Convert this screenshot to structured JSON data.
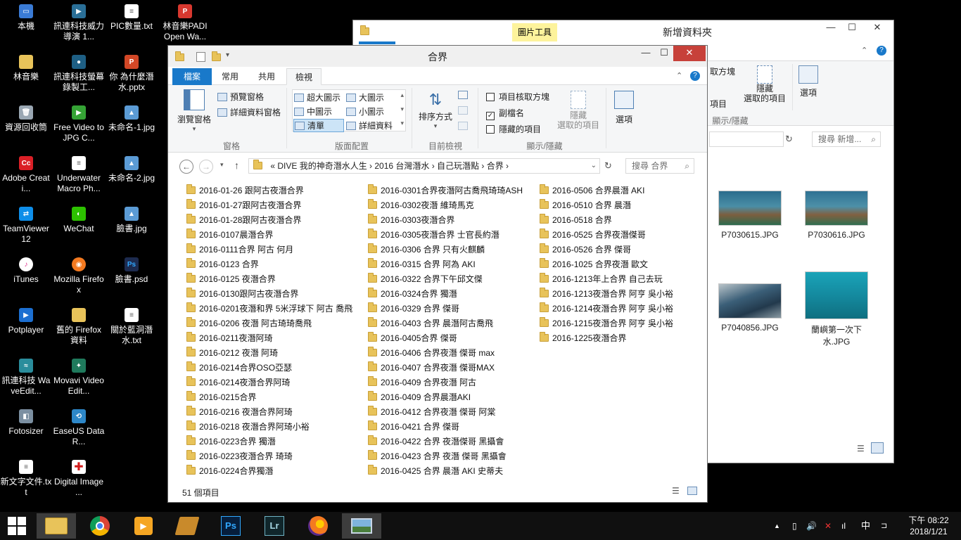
{
  "desktop": {
    "icons": [
      {
        "label": "本機"
      },
      {
        "label": "訊連科技威力導演 1..."
      },
      {
        "label": "PIC數量.txt"
      },
      {
        "label": "林音樂PADI Open Wa..."
      },
      {
        "label": "林音樂"
      },
      {
        "label": "訊連科技螢幕錄製工..."
      },
      {
        "label": "你 為什麼潛水.pptx"
      },
      {
        "label": "資源回收筒"
      },
      {
        "label": "Free Video to JPG C..."
      },
      {
        "label": "未命名-1.jpg"
      },
      {
        "label": "Adobe Creati..."
      },
      {
        "label": "Underwater Macro Ph..."
      },
      {
        "label": "未命名-2.jpg"
      },
      {
        "label": "TeamViewer 12"
      },
      {
        "label": "WeChat"
      },
      {
        "label": "臉書.jpg"
      },
      {
        "label": "iTunes"
      },
      {
        "label": "Mozilla Firefox"
      },
      {
        "label": "臉書.psd"
      },
      {
        "label": "Potplayer"
      },
      {
        "label": "舊的 Firefox 資料"
      },
      {
        "label": "關於藍洞潛水.txt"
      },
      {
        "label": "訊連科技 WaveEdit..."
      },
      {
        "label": "Movavi Video Edit..."
      },
      {
        "label": "Fotosizer"
      },
      {
        "label": "EaseUS Data R..."
      },
      {
        "label": "新文字文件.txt"
      },
      {
        "label": "Digital Image ..."
      }
    ]
  },
  "back_window": {
    "title": "新增資料夾",
    "context_tab": "圖片工具",
    "ribbon": {
      "item_checkbox_partial": "取方塊",
      "item_ext_partial": "項目",
      "hide_selected": "隱藏\n選取的項目",
      "options": "選項",
      "group_show_hide": "顯示/隱藏"
    },
    "search_placeholder": "搜尋 新增...",
    "thumbnails": [
      {
        "name": "P7030615.JPG"
      },
      {
        "name": "P7030616.JPG"
      },
      {
        "name": "P7040856.JPG"
      },
      {
        "name": "蘭嶼第一次下水.JPG"
      }
    ]
  },
  "front_window": {
    "title": "合界",
    "tabs": {
      "file": "檔案",
      "home": "常用",
      "share": "共用",
      "view": "檢視"
    },
    "ribbon": {
      "nav_pane": "瀏覽窗格",
      "preview_pane": "預覽窗格",
      "details_pane": "詳細資料窗格",
      "group_panes": "窗格",
      "layout": [
        "超大圖示",
        "大圖示",
        "中圖示",
        "小圖示",
        "清單",
        "詳細資料"
      ],
      "group_layout": "版面配置",
      "sort_by": "排序方式",
      "group_current_view": "目前檢視",
      "item_checkboxes": "項目核取方塊",
      "file_ext": "副檔名",
      "hidden_items": "隱藏的項目",
      "hide_selected": "隱藏\n選取的項目",
      "group_show_hide": "顯示/隱藏",
      "options": "選項"
    },
    "breadcrumb": "«  DIVE 我的神奇潛水人生  ›  2016 台灣潛水  ›  自己玩潛點  ›  合界  ›",
    "search_placeholder": "搜尋 合界",
    "folders_col1": [
      "2016-01-26 跟阿古夜潛合界",
      "2016-01-27跟阿古夜潛合界",
      "2016-01-28跟阿古夜潛合界",
      "2016-0107晨潛合界",
      "2016-0111合界 阿古 何月",
      "2016-0123 合界",
      "2016-0125 夜潛合界",
      "2016-0130跟阿古夜潛合界",
      "2016-0201夜潛和界 5米浮球下 阿古 喬飛",
      "2016-0206 夜潛 阿古琦琦喬飛",
      "2016-0211夜潛阿琦",
      "2016-0212 夜潛 阿琦",
      "2016-0214合界OSO亞瑟",
      "2016-0214夜潛合界阿琦",
      "2016-0215合界",
      "2016-0216 夜潛合界阿琦",
      "2016-0218 夜潛合界阿琦小裕",
      "2016-0223合界 獨潛",
      "2016-0223夜潛合界 琦琦",
      "2016-0224合界獨潛"
    ],
    "folders_col2": [
      "2016-0301合界夜潛阿古喬飛琦琦ASH",
      "2016-0302夜潛 維琦馬克",
      "2016-0303夜潛合界",
      "2016-0305夜潛合界 士官長約潛",
      "2016-0306 合界 只有火麒麟",
      "2016-0315 合界 阿為 AKI",
      "2016-0322 合界下午邱文傑",
      "2016-0324合界 獨潛",
      "2016-0329 合界 傑哥",
      "2016-0403 合界 晨潛阿古喬飛",
      "2016-0405合界 傑哥",
      "2016-0406 合界夜潛 傑哥 max",
      "2016-0407 合界夜潛 傑哥MAX",
      "2016-0409 合界夜潛 阿古",
      "2016-0409 合界晨潛AKI",
      "2016-0412 合界夜潛 傑哥 阿棠",
      "2016-0421 合界 傑哥",
      "2016-0422 合界 夜潛傑哥 黑攝會",
      "2016-0423 合界 夜潛 傑哥 黑攝會",
      "2016-0425 合界 晨潛 AKI 史蒂夫"
    ],
    "folders_col3": [
      "2016-0506 合界晨潛 AKI",
      "2016-0510 合界 晨潛",
      "2016-0518 合界",
      "2016-0525 合界夜潛傑哥",
      "2016-0526 合界 傑哥",
      "2016-1025 合界夜潛 歐文",
      "2016-1213年上合界 自己去玩",
      "2016-1213夜潛合界 阿亨 吳小裕",
      "2016-1214夜潛合界 阿亨 吳小裕",
      "2016-1215夜潛合界 阿亨 吳小裕",
      "2016-1225夜潛合界"
    ],
    "status_count": "51 個項目"
  },
  "taskbar": {
    "apps": [
      "file-explorer",
      "chrome",
      "media-player",
      "video-editor",
      "photoshop",
      "lightroom",
      "firefox",
      "photos"
    ],
    "ime": "中",
    "time": "下午 08:22",
    "date": "2018/1/21"
  },
  "colors": {
    "accent": "#1979ca",
    "close": "#c7413a",
    "folder": "#e8c35a"
  }
}
